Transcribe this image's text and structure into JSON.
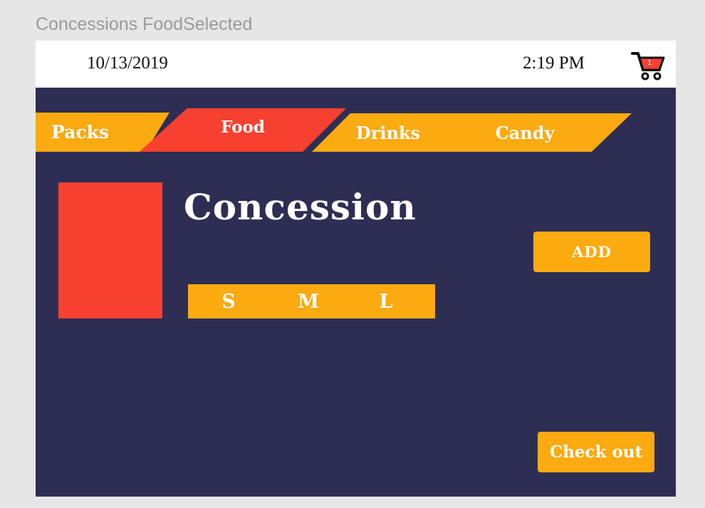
{
  "frame": {
    "title": "Concessions FoodSelected"
  },
  "header": {
    "date": "10/13/2019",
    "time": "2:19 PM",
    "cart": {
      "count": "1",
      "icon": "shopping-cart-icon"
    }
  },
  "tabs": [
    {
      "label": "Packs",
      "selected": false
    },
    {
      "label": "Food",
      "selected": true
    },
    {
      "label": "Drinks",
      "selected": false
    },
    {
      "label": "Candy",
      "selected": false
    }
  ],
  "product": {
    "title": "Concession",
    "sizes": [
      "S",
      "M",
      "L"
    ],
    "add_label": "ADD"
  },
  "footer": {
    "checkout_label": "Check out"
  },
  "colors": {
    "background": "#2e2e54",
    "accent": "#fbaa10",
    "selected": "#f84030",
    "frame": "#e6e6e6"
  }
}
